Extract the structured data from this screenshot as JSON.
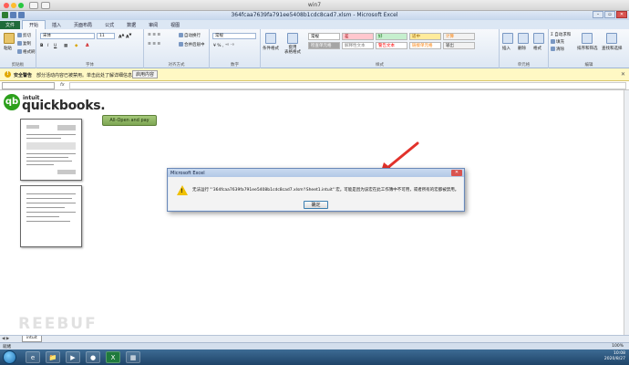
{
  "mac": {
    "title": "win7"
  },
  "excel": {
    "window_title": "364fcaa7639fa791ee5408b1cdc8cad7.xlsm - Microsoft Excel",
    "tabs": [
      "文件",
      "开始",
      "插入",
      "页面布局",
      "公式",
      "数据",
      "审阅",
      "视图"
    ],
    "active_tab": "开始"
  },
  "ribbon": {
    "clipboard": {
      "paste": "粘贴",
      "cut": "剪切",
      "copy": "复制",
      "format_painter": "格式刷",
      "label": "剪贴板"
    },
    "font": {
      "name": "宋体",
      "size": "11",
      "label": "字体"
    },
    "alignment": {
      "wrap": "自动换行",
      "merge": "合并后居中",
      "label": "对齐方式"
    },
    "number": {
      "format": "常规",
      "label": "数字"
    },
    "styles": {
      "conditional": "条件格式",
      "table": "套用\n表格格式",
      "cells": [
        {
          "text": "常规",
          "bg": "#ffffff",
          "fg": "#000000"
        },
        {
          "text": "差",
          "bg": "#ffc7ce",
          "fg": "#9c0006"
        },
        {
          "text": "好",
          "bg": "#c6efce",
          "fg": "#006100"
        },
        {
          "text": "适中",
          "bg": "#ffeb9c",
          "fg": "#9c6500"
        },
        {
          "text": "计算",
          "bg": "#f2f2f2",
          "fg": "#fa7d00"
        },
        {
          "text": "检查单元格",
          "bg": "#a5a5a5",
          "fg": "#ffffff"
        },
        {
          "text": "解释性文本",
          "bg": "#ffffff",
          "fg": "#7f7f7f"
        },
        {
          "text": "警告文本",
          "bg": "#ffffff",
          "fg": "#ff0000"
        },
        {
          "text": "链接单元格",
          "bg": "#ffffff",
          "fg": "#fa7d00"
        },
        {
          "text": "输出",
          "bg": "#f2f2f2",
          "fg": "#3f3f3f"
        }
      ],
      "label": "样式"
    },
    "cells_group": {
      "insert": "插入",
      "delete": "删除",
      "format": "格式",
      "label": "单元格"
    },
    "editing": {
      "autosum": "自动求和",
      "fill": "填充",
      "clear": "清除",
      "sort": "排序和筛选",
      "find": "查找和选择",
      "label": "编辑"
    }
  },
  "security_bar": {
    "label": "安全警告",
    "message": "部分活动内容已被禁用。单击此处了解详细信息。",
    "button": "启用内容"
  },
  "formula_bar": {
    "name_box": "",
    "fx": "fx",
    "formula": ""
  },
  "sheet": {
    "logo_glyph": "qb",
    "logo_small": "intuit",
    "logo_text": "quickbooks.",
    "shape_button": "All-Open and pay"
  },
  "dialog": {
    "title": "Microsoft Excel",
    "warn_mark": "!",
    "message": "无法运行 \"'364fcaa7639fa791ee5408b1cdc8cad7.xlsm'!Sheet1.intuit\" 宏。可能是因为该宏在此工作簿中不可用，或者所有的宏都被禁用。",
    "ok": "确定"
  },
  "sheettabs": {
    "nav": "◀ ▶",
    "sheet1": "intuit"
  },
  "status": {
    "ready": "就绪",
    "zoom": "100%"
  },
  "taskbar": {
    "apps": [
      "e",
      "📁",
      "▶",
      "●",
      "X",
      "▦"
    ],
    "time": "10:08",
    "date": "2020/8/27"
  },
  "watermark": "REEBUF"
}
